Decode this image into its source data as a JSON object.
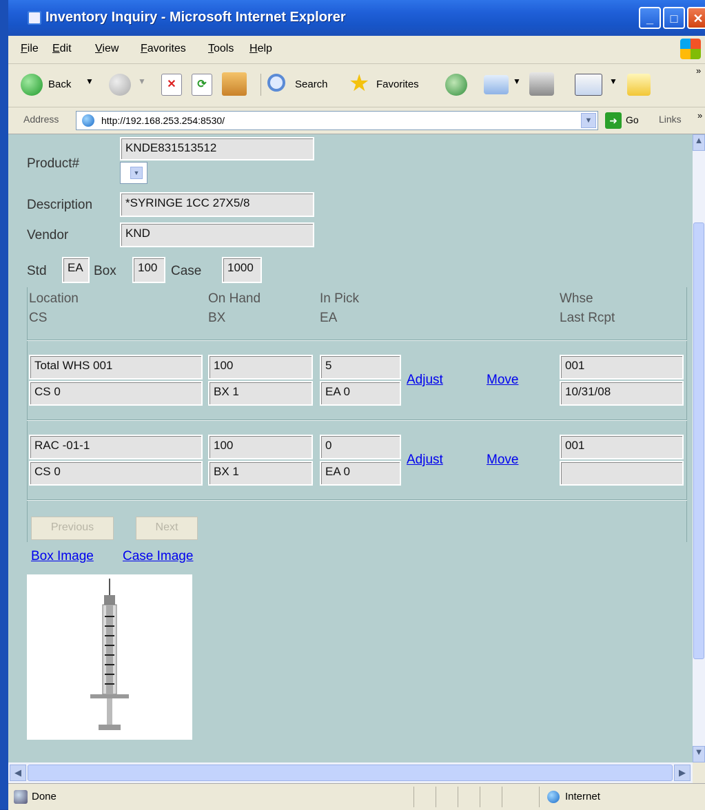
{
  "window": {
    "title": "Inventory Inquiry - Microsoft Internet Explorer"
  },
  "menu": [
    {
      "label": "File",
      "first": "F",
      "rest": "ile"
    },
    {
      "label": "Edit",
      "first": "E",
      "rest": "dit"
    },
    {
      "label": "View",
      "first": "V",
      "rest": "iew"
    },
    {
      "label": "Favorites",
      "first": "F",
      "rest": "avorites"
    },
    {
      "label": "Tools",
      "first": "T",
      "rest": "ools"
    },
    {
      "label": "Help",
      "first": "H",
      "rest": "elp"
    }
  ],
  "toolbar": {
    "back": "Back",
    "search": "Search",
    "favorites": "Favorites"
  },
  "address": {
    "label": "Address",
    "url": "http://192.168.253.254:8530/",
    "go": "Go",
    "links": "Links"
  },
  "form": {
    "product_label": "Product#",
    "product_value": "KNDE831513512",
    "description_label": "Description",
    "description_value": "*SYRINGE 1CC 27X5/8",
    "vendor_label": "Vendor",
    "vendor_value": "KND",
    "std_label": "Std",
    "std_value": "EA",
    "box_label": "Box",
    "box_value": "100",
    "case_label": "Case",
    "case_value": "1000"
  },
  "headers": {
    "location": "Location",
    "cs": "CS",
    "onhand": "On Hand",
    "bx": "BX",
    "inpick": "In Pick",
    "ea": "EA",
    "whse": "Whse",
    "last_rcpt": "Last Rcpt"
  },
  "rows": [
    {
      "location": "Total WHS 001",
      "onhand": "100",
      "inpick": "5",
      "cs": "CS 0",
      "bx": "BX 1",
      "ea": "EA 0",
      "whse": "001",
      "last_rcpt": "10/31/08",
      "adjust": "Adjust",
      "move": "Move"
    },
    {
      "location": "RAC -01-1",
      "onhand": "100",
      "inpick": "0",
      "cs": "CS 0",
      "bx": "BX 1",
      "ea": "EA 0",
      "whse": "001",
      "last_rcpt": "",
      "adjust": "Adjust",
      "move": "Move"
    }
  ],
  "buttons": {
    "previous": "Previous",
    "next": "Next"
  },
  "links": {
    "box_image": "Box Image",
    "case_image": "Case Image"
  },
  "status": {
    "text": "Done",
    "zone": "Internet"
  }
}
